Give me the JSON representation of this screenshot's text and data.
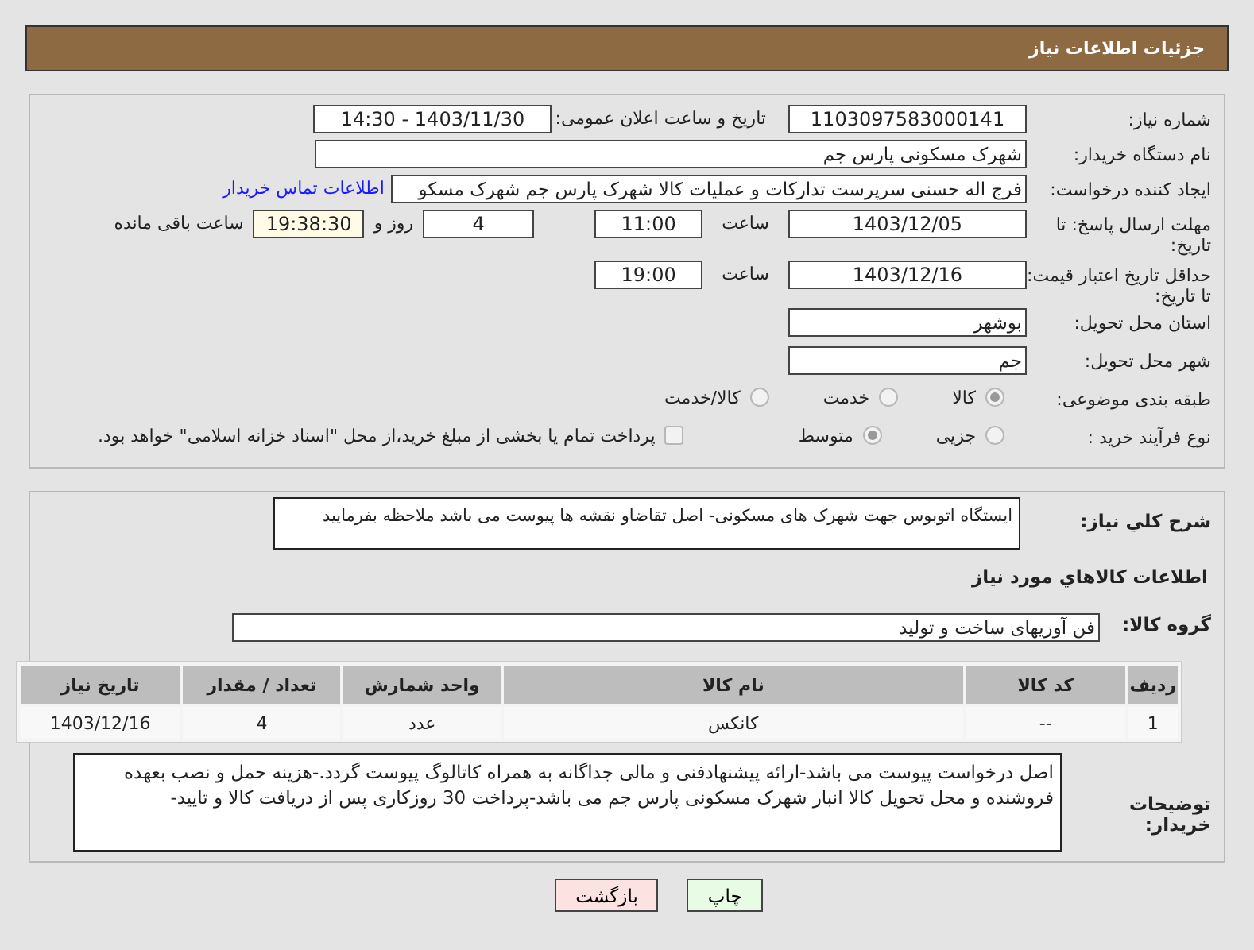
{
  "header": {
    "title": "جزئیات اطلاعات نیاز"
  },
  "need_number": {
    "label": "شماره نیاز:",
    "value": "1103097583000141"
  },
  "announce": {
    "label": "تاریخ و ساعت اعلان عمومی:",
    "value": "1403/11/30 - 14:30"
  },
  "buyer": {
    "label": "نام دستگاه خریدار:",
    "value": "شهرک مسکونی پارس جم"
  },
  "creator": {
    "label": "ایجاد کننده درخواست:",
    "value": "فرج اله حسنی سرپرست تدارکات و عملیات کالا شهرک پارس جم شهرک مسکو",
    "link": "اطلاعات تماس خریدار"
  },
  "reply_deadline": {
    "label": "مهلت ارسال پاسخ: تا تاریخ:",
    "date": "1403/12/05",
    "time_label": "ساعت",
    "time": "11:00",
    "days": "4",
    "days_label": "روز و",
    "remaining": "19:38:30",
    "remaining_label": "ساعت باقی مانده"
  },
  "price_validity": {
    "label": "حداقل تاریخ اعتبار قیمت: تا تاریخ:",
    "date": "1403/12/16",
    "time_label": "ساعت",
    "time": "19:00"
  },
  "province": {
    "label": "استان محل تحویل:",
    "value": "بوشهر"
  },
  "city": {
    "label": "شهر محل تحویل:",
    "value": "جم"
  },
  "category": {
    "label": "طبقه بندی موضوعی:",
    "options": [
      {
        "label": "کالا",
        "selected": true
      },
      {
        "label": "خدمت",
        "selected": false
      },
      {
        "label": "کالا/خدمت",
        "selected": false
      }
    ]
  },
  "process": {
    "label": "نوع فرآیند خرید :",
    "options": [
      {
        "label": "جزیی",
        "selected": false
      },
      {
        "label": "متوسط",
        "selected": true
      }
    ],
    "payment": {
      "label": "پرداخت تمام یا بخشی از مبلغ خرید،از محل \"اسناد خزانه اسلامی\" خواهد بود.",
      "checked": false
    }
  },
  "description": {
    "label": "شرح کلي نياز:",
    "value": "ایستگاه اتوبوس جهت شهرک های مسکونی- اصل تقاضاو نقشه ها  پیوست می باشد ملاحظه بفرمایید"
  },
  "items_title": "اطلاعات کالاهاي مورد نياز",
  "goods_group": {
    "label": "گروه کالا:",
    "value": "فن آوریهای ساخت و تولید"
  },
  "table": {
    "columns": [
      "ردیف",
      "کد کالا",
      "نام کالا",
      "واحد شمارش",
      "تعداد / مقدار",
      "تاریخ نیاز"
    ],
    "rows": [
      [
        "1",
        "--",
        "کانکس",
        "عدد",
        "4",
        "1403/12/16"
      ]
    ]
  },
  "buyer_notes": {
    "label": "توضیحات خریدار:",
    "value": "اصل درخواست پیوست می باشد-ارائه پیشنهادفنی و مالی جداگانه به همراه کاتالوگ پیوست گردد.-هزینه حمل و نصب بعهده فروشنده و محل تحویل کالا انبار شهرک مسکونی پارس جم می باشد-پرداخت 30 روزکاری پس از دریافت کالا و تایید-"
  },
  "buttons": [
    {
      "label": "چاپ",
      "kind": "print"
    },
    {
      "label": "بازگشت",
      "kind": "back"
    }
  ]
}
